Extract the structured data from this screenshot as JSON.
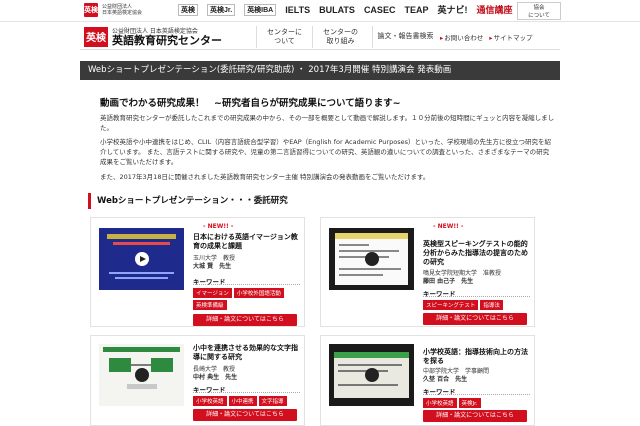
{
  "header": {
    "badge": "英検",
    "org_line1": "公益財団法人",
    "org_line2": "日本英語検定協会",
    "links": [
      "英検",
      "英検Jr.",
      "英検IBA",
      "IELTS",
      "BULATS",
      "CASEC",
      "TEAP",
      "英ナビ!",
      "通信講座"
    ],
    "about_button": "協会\nについて"
  },
  "nav": {
    "logo_line1": "公益財団法人 日本英語検定協会",
    "logo_line2": "英語教育研究センター",
    "buttons": [
      "センターに\nついて",
      "センターの\n取り組み",
      "論文・報告書検索"
    ],
    "links": [
      "お問い合わせ",
      "サイトマップ"
    ]
  },
  "title_bar": "Webショートプレゼンテーション(委託研究/研究助成) ・ 2017年3月開催 特別講演会 発表動画",
  "lead": {
    "title": "動画でわかる研究成果！　~研究者自らが研究成果について語ります~",
    "paragraphs": [
      "英語教育研究センターが委託したこれまでの研究成果の中から、その一部を概要として動画で解説します。１０分前後の短時間にギュッと内容を凝縮しました。",
      "小学校英語や小中連携をはじめ、CLIL（内容言語統合型学習）やEAP（English for Academic Purposes）といった、学校現場の先生方に役立つ研究を紹介しています。 また、言語テストに関する研究や、児童の第二言語習得についての研究、英語観の違いについての調査といった、さまざまなテーマの研究成果をご覧いただけます。",
      "また、2017年3月18日に開催されました英語教育研究センター主催 特別講演会の発表動画をご覧いただけます。"
    ]
  },
  "section": {
    "title": "Webショートプレゼンテーション・・・委託研究"
  },
  "cards": [
    {
      "new": "- NEW!! -",
      "title": "日本における英語イマージョン教育の成果と課題",
      "affiliation": "玉川大学　教授",
      "name": "大城 賢　先生",
      "keyword_label": "キーワード",
      "tags": [
        "イマージョン",
        "小学校外国語活動",
        "英検準備級"
      ],
      "detail": "詳細・論文についてはこちら",
      "thumb_bg": "#1f2b8c",
      "thumb_accent": "#f2d22e"
    },
    {
      "new": "- NEW!! -",
      "title": "英検型スピーキングテストの能的分析からみた指導法の提言のための研究",
      "affiliation": "鳴見女学院短期大学　准教授",
      "name": "藤田 由己子　先生",
      "keyword_label": "キーワード",
      "tags": [
        "スピーキングテスト",
        "指導法"
      ],
      "detail": "詳細・論文についてはこちら",
      "thumb_bg": "#1b1b1b",
      "thumb_accent": "#e6d46a"
    },
    {
      "new": "",
      "title": "小中を連携させる効果的な文字指導に関する研究",
      "affiliation": "長崎大学　教授",
      "name": "中村 典生　先生",
      "keyword_label": "キーワード",
      "tags": [
        "小学校英語",
        "小中連携",
        "文字指導"
      ],
      "detail": "詳細・論文についてはこちら",
      "thumb_bg": "#f4f4f0",
      "thumb_accent": "#2e8a3e"
    },
    {
      "new": "",
      "title": "小学校英語：指導技術向上の方法を探る",
      "affiliation": "中部学院大学　学事顧問",
      "name": "久埜 百合　先生",
      "keyword_label": "キーワード",
      "tags": [
        "小学校英語",
        "英検Jr."
      ],
      "detail": "詳細・論文についてはこちら",
      "thumb_bg": "#1a1a1a",
      "thumb_accent": "#3aa04a"
    }
  ]
}
